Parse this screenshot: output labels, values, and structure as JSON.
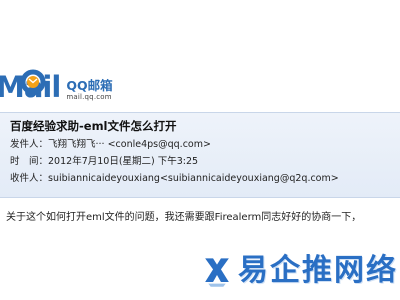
{
  "logo": {
    "wordmark": "Mail",
    "product": "QQ邮箱",
    "domain": "mail.qq.com",
    "brand_color": "#2c6db5"
  },
  "email": {
    "subject": "百度经验求助-eml文件怎么打开",
    "from_label": "发件人：",
    "from_value": "飞翔飞翔飞··· <conle4ps@qq.com>",
    "time_label": "时　间：",
    "time_value": "2012年7月10日(星期二) 下午3:25",
    "to_label": "收件人：",
    "to_value": "suibiannicaideyouxiang<suibiannicaideyouxiang@q2q.com>",
    "body": "关于这个如何打开eml文件的问题，我还需要跟Firealerm同志好好的协商一下，",
    "header_bg": "#e8eff9"
  },
  "watermark": {
    "text": "易企推网络",
    "color": "#2a6fc4"
  }
}
